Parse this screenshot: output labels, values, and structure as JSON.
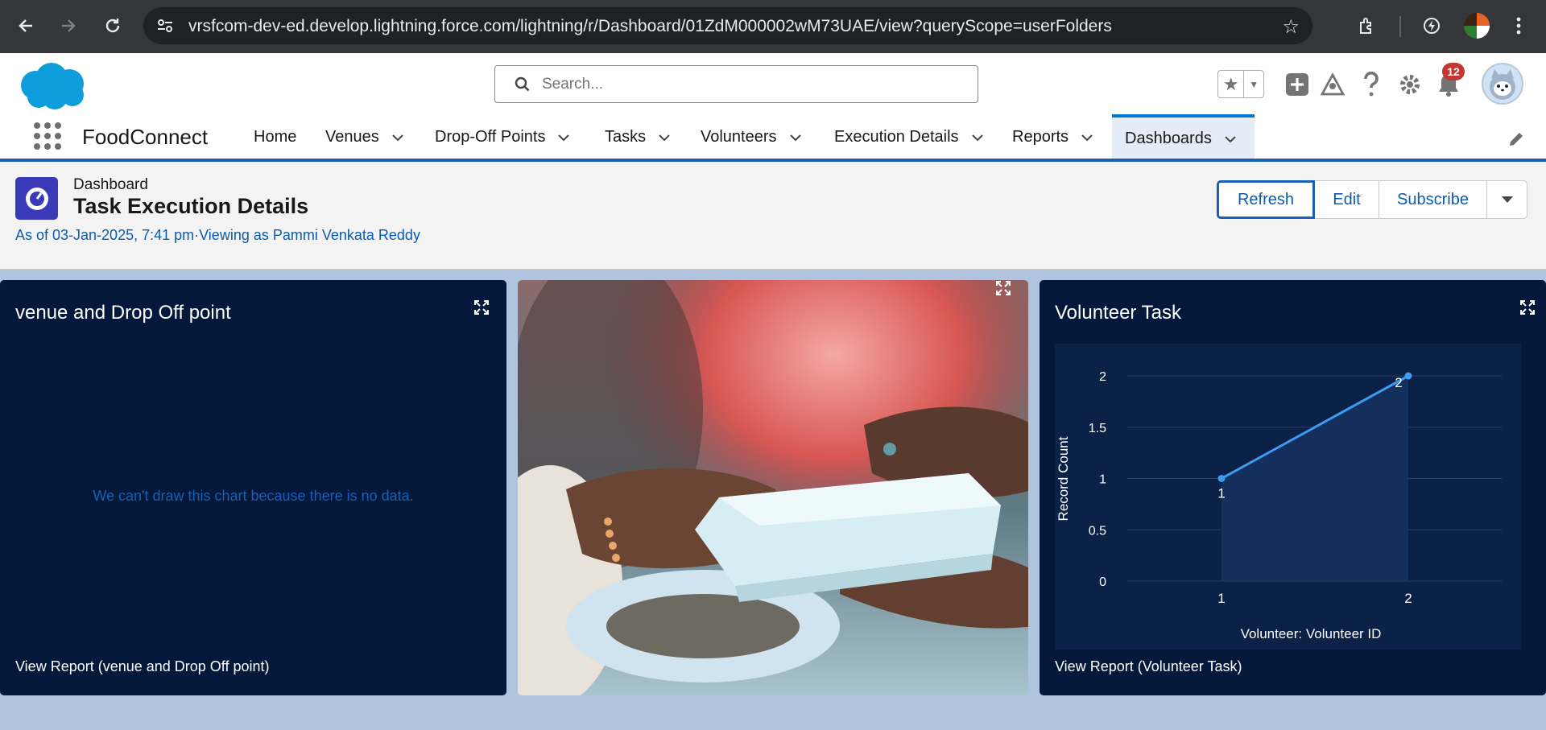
{
  "browser": {
    "url": "vrsfcom-dev-ed.develop.lightning.force.com/lightning/r/Dashboard/01ZdM000002wM73UAE/view?queryScope=userFolders"
  },
  "header": {
    "search_placeholder": "Search...",
    "notification_count": "12"
  },
  "nav": {
    "app_name": "FoodConnect",
    "items": [
      {
        "label": "Home",
        "has_menu": false
      },
      {
        "label": "Venues",
        "has_menu": true
      },
      {
        "label": "Drop-Off Points",
        "has_menu": true
      },
      {
        "label": "Tasks",
        "has_menu": true
      },
      {
        "label": "Volunteers",
        "has_menu": true
      },
      {
        "label": "Execution Details",
        "has_menu": true
      },
      {
        "label": "Reports",
        "has_menu": true
      },
      {
        "label": "Dashboards",
        "has_menu": true,
        "active": true
      }
    ]
  },
  "dashboard": {
    "label": "Dashboard",
    "title": "Task Execution Details",
    "meta": "As of 03-Jan-2025, 7:41 pm·Viewing as Pammi Venkata Reddy",
    "buttons": {
      "refresh": "Refresh",
      "edit": "Edit",
      "subscribe": "Subscribe"
    }
  },
  "cards": {
    "venue": {
      "title": "venue and Drop Off point",
      "no_data": "We can't draw this chart because there is no data.",
      "footer": "View Report (venue and Drop Off point)"
    },
    "volunteer": {
      "title": "Volunteer Task",
      "footer": "View Report (Volunteer Task)"
    }
  },
  "colors": {
    "card_bg": "#03183a",
    "chart_bg": "#0b2148",
    "line": "#3d9cf0",
    "accent": "#1b5fb4"
  },
  "chart_data": {
    "type": "line",
    "title": "Volunteer Task",
    "xlabel": "Volunteer: Volunteer ID",
    "ylabel": "Record Count",
    "categories": [
      "1",
      "2"
    ],
    "series": [
      {
        "values": [
          1,
          2
        ]
      }
    ],
    "data_labels": [
      "1",
      "2"
    ],
    "yticks": [
      "0",
      "0.5",
      "1",
      "1.5",
      "2"
    ],
    "ylim": [
      0,
      2
    ],
    "grid": true,
    "area_fill": true
  }
}
